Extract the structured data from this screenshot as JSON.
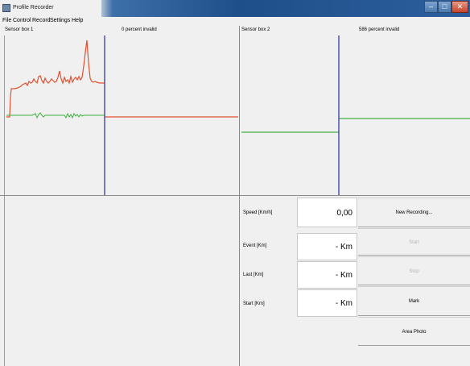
{
  "window": {
    "title": "Profile Recorder"
  },
  "menu": [
    "File",
    "Control",
    "Record",
    "Settings",
    "Help"
  ],
  "sensor1": {
    "label": "Sensor box 1",
    "status": "0 percent invalid"
  },
  "sensor2": {
    "label": "Sensor box 2",
    "status": "586 percent invalid"
  },
  "fields": {
    "speed": {
      "label": "Speed [Km/h]",
      "value": "0,00"
    },
    "event": {
      "label": "Event [Km]",
      "value": "- Km"
    },
    "last": {
      "label": "Last [Km]",
      "value": "- Km"
    },
    "start": {
      "label": "Start [Km]",
      "value": "- Km"
    }
  },
  "buttons": {
    "new_recording": "New Recording...",
    "start": "Start",
    "stop": "Stop",
    "mark": "Mark",
    "area_photo": "Area Photo"
  },
  "colors": {
    "trace_red": "#e05030",
    "trace_green": "#40b040",
    "cursor_blue": "#3838a0"
  }
}
